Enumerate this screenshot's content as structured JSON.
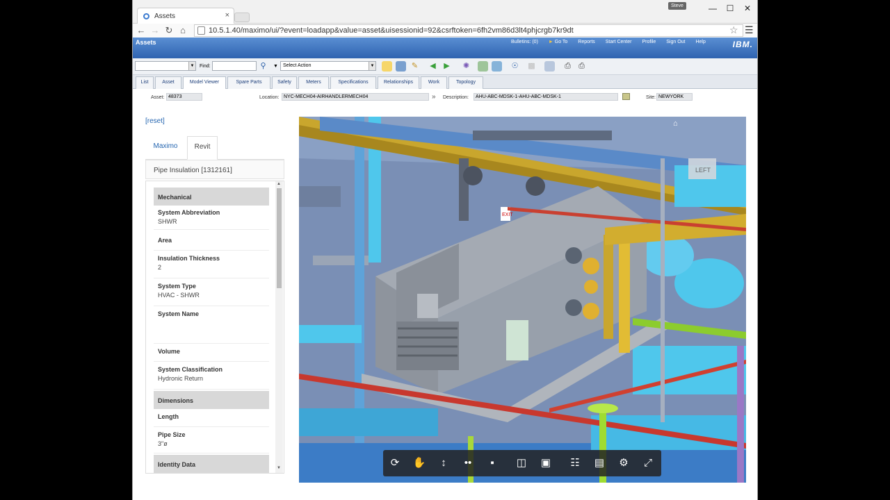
{
  "browser": {
    "tab_title": "Assets",
    "user_badge": "Steve",
    "url": "10.5.1.40/maximo/ui/?event=loadapp&value=asset&uisessionid=92&csrftoken=6fh2vm86d3lt4phjcrgb7kr9dt",
    "min": "—",
    "max": "☐",
    "close": "✕",
    "tab_close": "×"
  },
  "header": {
    "app_title": "Assets",
    "links": [
      "Bulletins: (0)",
      "Go To",
      "Reports",
      "Start Center",
      "Profile",
      "Sign Out",
      "Help"
    ],
    "logo": "IBM."
  },
  "toolbar": {
    "find_label": "Find:",
    "select_action": "Select Action"
  },
  "tabs": [
    "List",
    "Asset",
    "Model Viewer",
    "Spare Parts",
    "Safety",
    "Meters",
    "Specifications",
    "Relationships",
    "Work",
    "Topology"
  ],
  "active_tab": "Model Viewer",
  "fields": {
    "asset_label": "Asset:",
    "asset_value": "48373",
    "location_label": "Location:",
    "location_value": "NYC-MECH04-AIRHANDLERMECH04",
    "description_label": "Description:",
    "description_value": "AHU-ABC-MDSK-1-AHU-ABC-MDSK-1",
    "site_label": "Site:",
    "site_value": "NEWYORK"
  },
  "panel": {
    "reset": "[reset]",
    "tab_maximo": "Maximo",
    "tab_revit": "Revit",
    "element_title": "Pipe Insulation [1312161]",
    "items": [
      {
        "type": "section",
        "name": "Mechanical"
      },
      {
        "type": "prop",
        "name": "System Abbreviation",
        "value": "SHWR"
      },
      {
        "type": "prop",
        "name": "Area",
        "value": ""
      },
      {
        "type": "prop",
        "name": "Insulation Thickness",
        "value": "2"
      },
      {
        "type": "prop",
        "name": "System Type",
        "value": "HVAC - SHWR"
      },
      {
        "type": "prop",
        "name": "System Name",
        "value": ""
      },
      {
        "type": "prop",
        "name": "Volume",
        "value": ""
      },
      {
        "type": "prop",
        "name": "System Classification",
        "value": "Hydronic Return"
      },
      {
        "type": "section",
        "name": "Dimensions"
      },
      {
        "type": "prop",
        "name": "Length",
        "value": ""
      },
      {
        "type": "prop",
        "name": "Pipe Size",
        "value": "3\"ø"
      },
      {
        "type": "section",
        "name": "Identity Data"
      }
    ]
  },
  "viewer": {
    "viewcube_face": "LEFT",
    "exit_sign": "EXIT"
  },
  "colors": {
    "header_top": "#5a8fd3",
    "header_bottom": "#2f63b0",
    "link": "#2465b0",
    "cyan_pipe": "#4fc7ec",
    "yellow_pipe": "#c9a62d",
    "green_pipe": "#8ccc2e",
    "unit_gray": "#8e98a6"
  }
}
